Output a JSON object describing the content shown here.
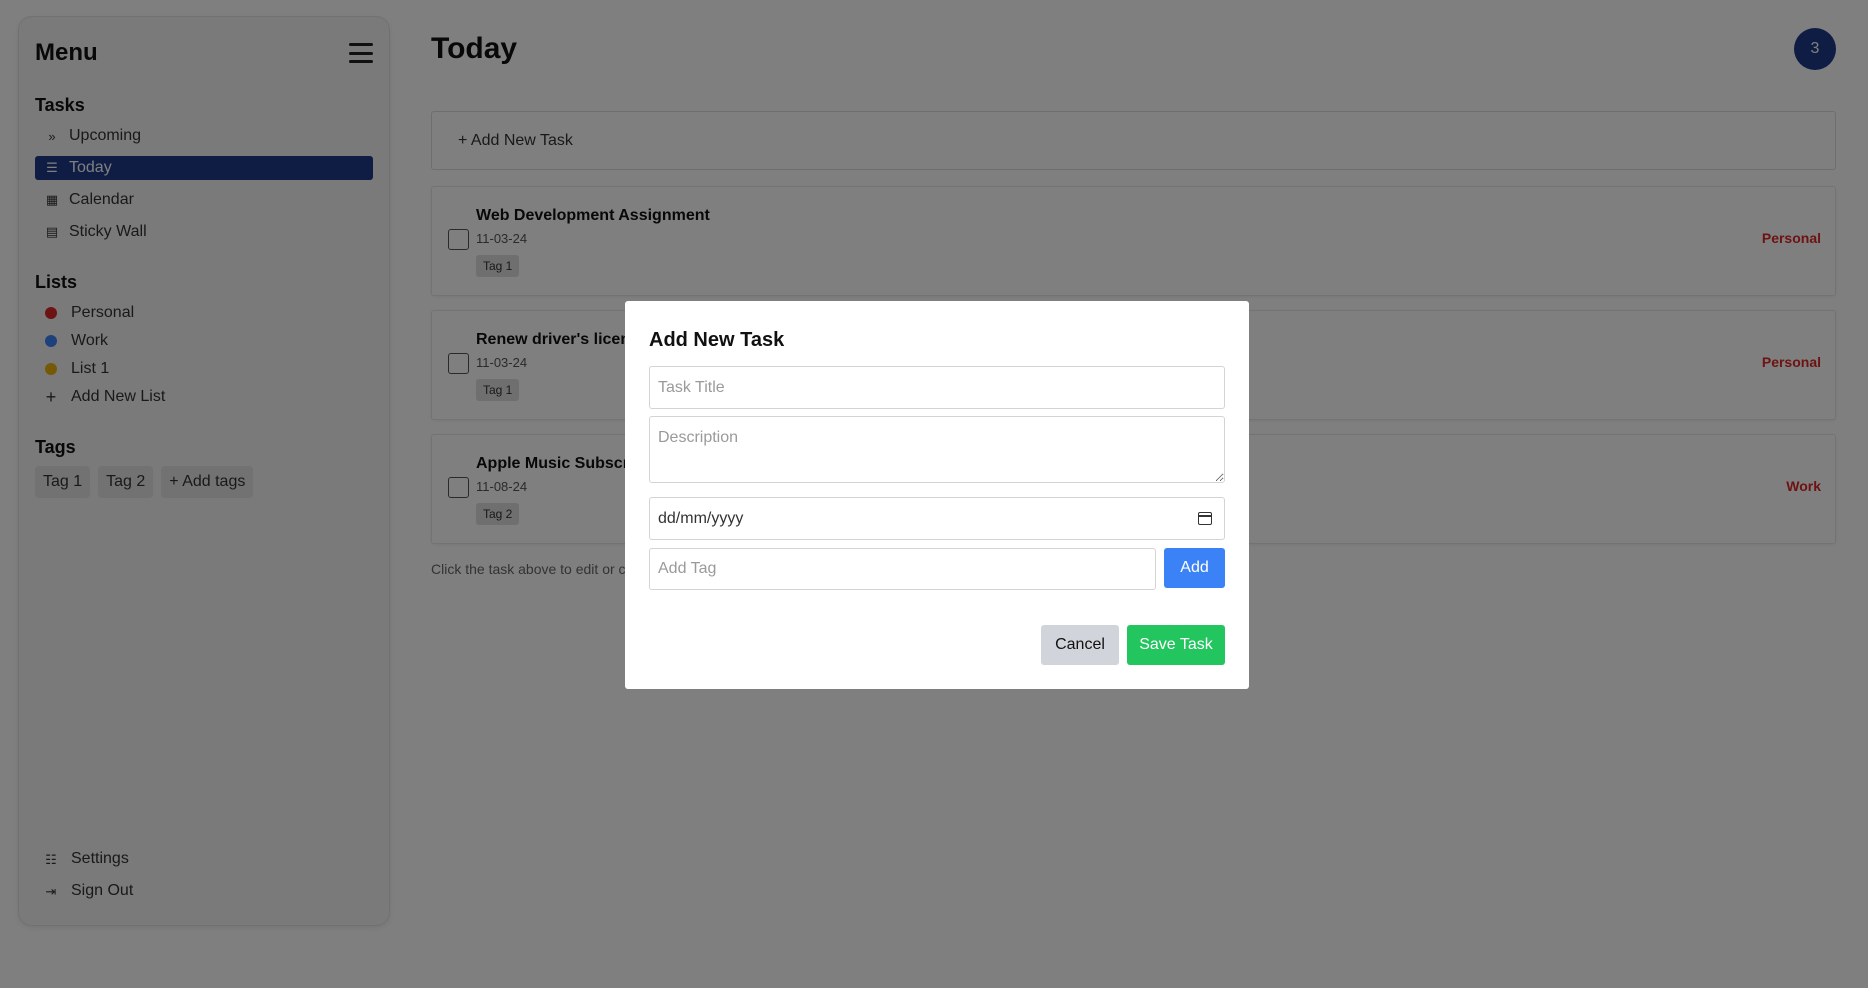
{
  "sidebar": {
    "title": "Menu",
    "tasks_heading": "Tasks",
    "task_items": [
      {
        "label": "Upcoming",
        "icon": "double-chevron-right-icon"
      },
      {
        "label": "Today",
        "icon": "list-icon",
        "active": true
      },
      {
        "label": "Calendar",
        "icon": "calendar-icon"
      },
      {
        "label": "Sticky Wall",
        "icon": "note-icon"
      }
    ],
    "lists_heading": "Lists",
    "lists": [
      {
        "label": "Personal",
        "color": "#dc2626"
      },
      {
        "label": "Work",
        "color": "#3b82f6"
      },
      {
        "label": "List 1",
        "color": "#eab308"
      }
    ],
    "add_list_label": "Add New List",
    "tags_heading": "Tags",
    "tags": [
      "Tag 1",
      "Tag 2"
    ],
    "add_tags_label": "+ Add tags",
    "settings_label": "Settings",
    "signout_label": "Sign Out"
  },
  "main": {
    "title": "Today",
    "count_badge": "3",
    "add_task_label": "+ Add New Task",
    "tasks": [
      {
        "title": "Web Development Assignment",
        "date": "11-03-24",
        "tag": "Tag 1",
        "list": "Personal"
      },
      {
        "title": "Renew driver's licens",
        "date": "11-03-24",
        "tag": "Tag 1",
        "list": "Personal"
      },
      {
        "title": "Apple Music Subscrip",
        "date": "11-08-24",
        "tag": "Tag 2",
        "list": "Work"
      }
    ],
    "hint": "Click the task above to edit or c"
  },
  "modal": {
    "title": "Add New Task",
    "title_placeholder": "Task Title",
    "description_placeholder": "Description",
    "date_placeholder": "dd/mm/yyyy",
    "tag_placeholder": "Add Tag",
    "add_label": "Add",
    "cancel_label": "Cancel",
    "save_label": "Save Task"
  },
  "colors": {
    "accent": "#1e3a8a",
    "add_button": "#3b82f6",
    "save_button": "#22c55e",
    "list_label": "#dc2626"
  }
}
